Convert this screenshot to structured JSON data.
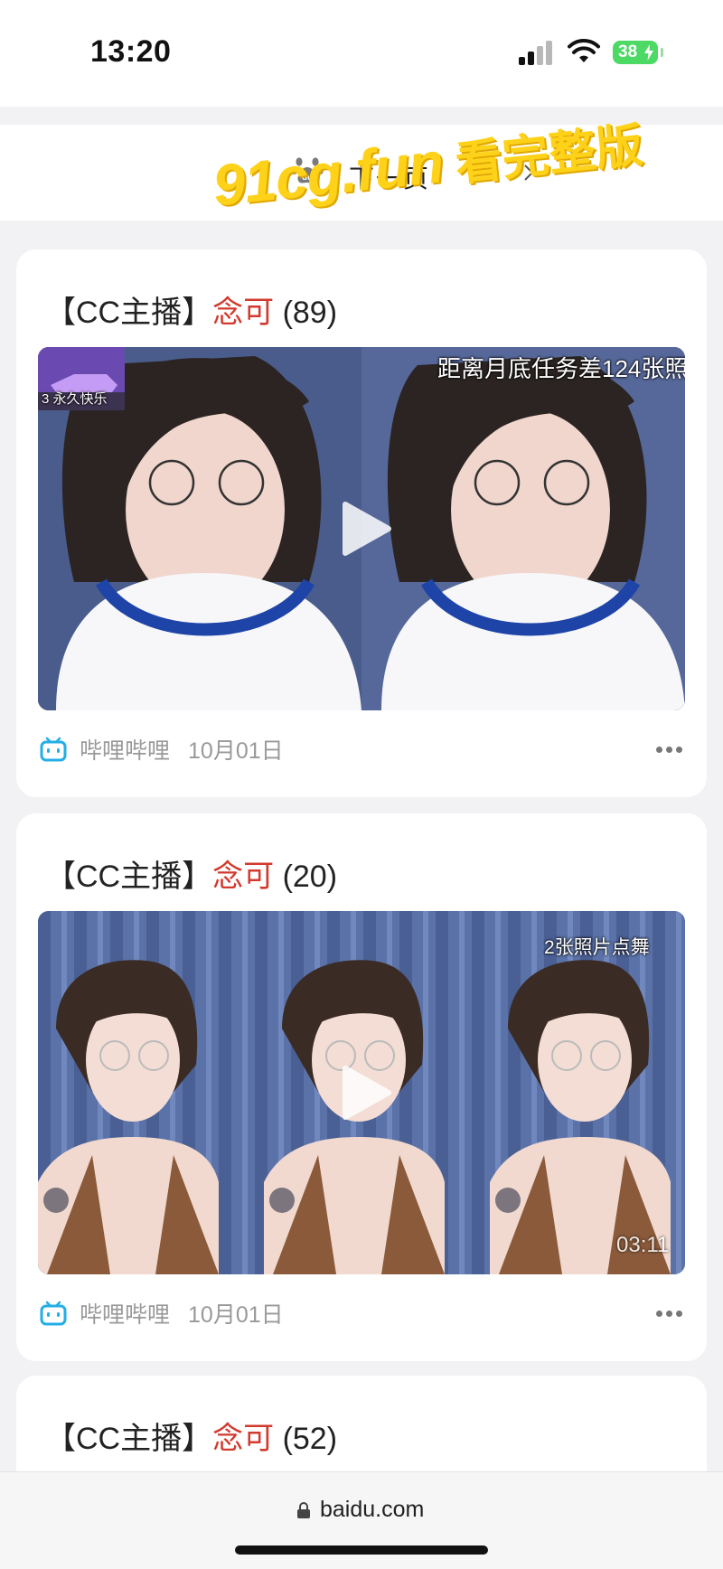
{
  "status_bar": {
    "time": "13:20",
    "battery": "38"
  },
  "nav": {
    "next_page_label": "下一页"
  },
  "watermark": {
    "url": "91cg.fun",
    "text": "看完整版"
  },
  "cards": [
    {
      "prefix": "【CC主播】",
      "name": "念可",
      "count": "(89)",
      "source": "哔哩哔哩",
      "date": "10月01日",
      "overlay_top": "距离月底任务差124张照",
      "overlay_badge": "3 永久快乐"
    },
    {
      "prefix": "【CC主播】",
      "name": "念可",
      "count": "(20)",
      "source": "哔哩哔哩",
      "date": "10月01日",
      "overlay_top": "2张照片点舞",
      "duration": "03:11"
    },
    {
      "prefix": "【CC主播】",
      "name": "念可",
      "count": "(52)"
    }
  ],
  "browser": {
    "url": "baidu.com"
  },
  "colors": {
    "accent_red": "#d23a2e",
    "bilibili_blue": "#23aee5",
    "battery_green": "#4cd964",
    "watermark_yellow": "#ffd21a"
  }
}
